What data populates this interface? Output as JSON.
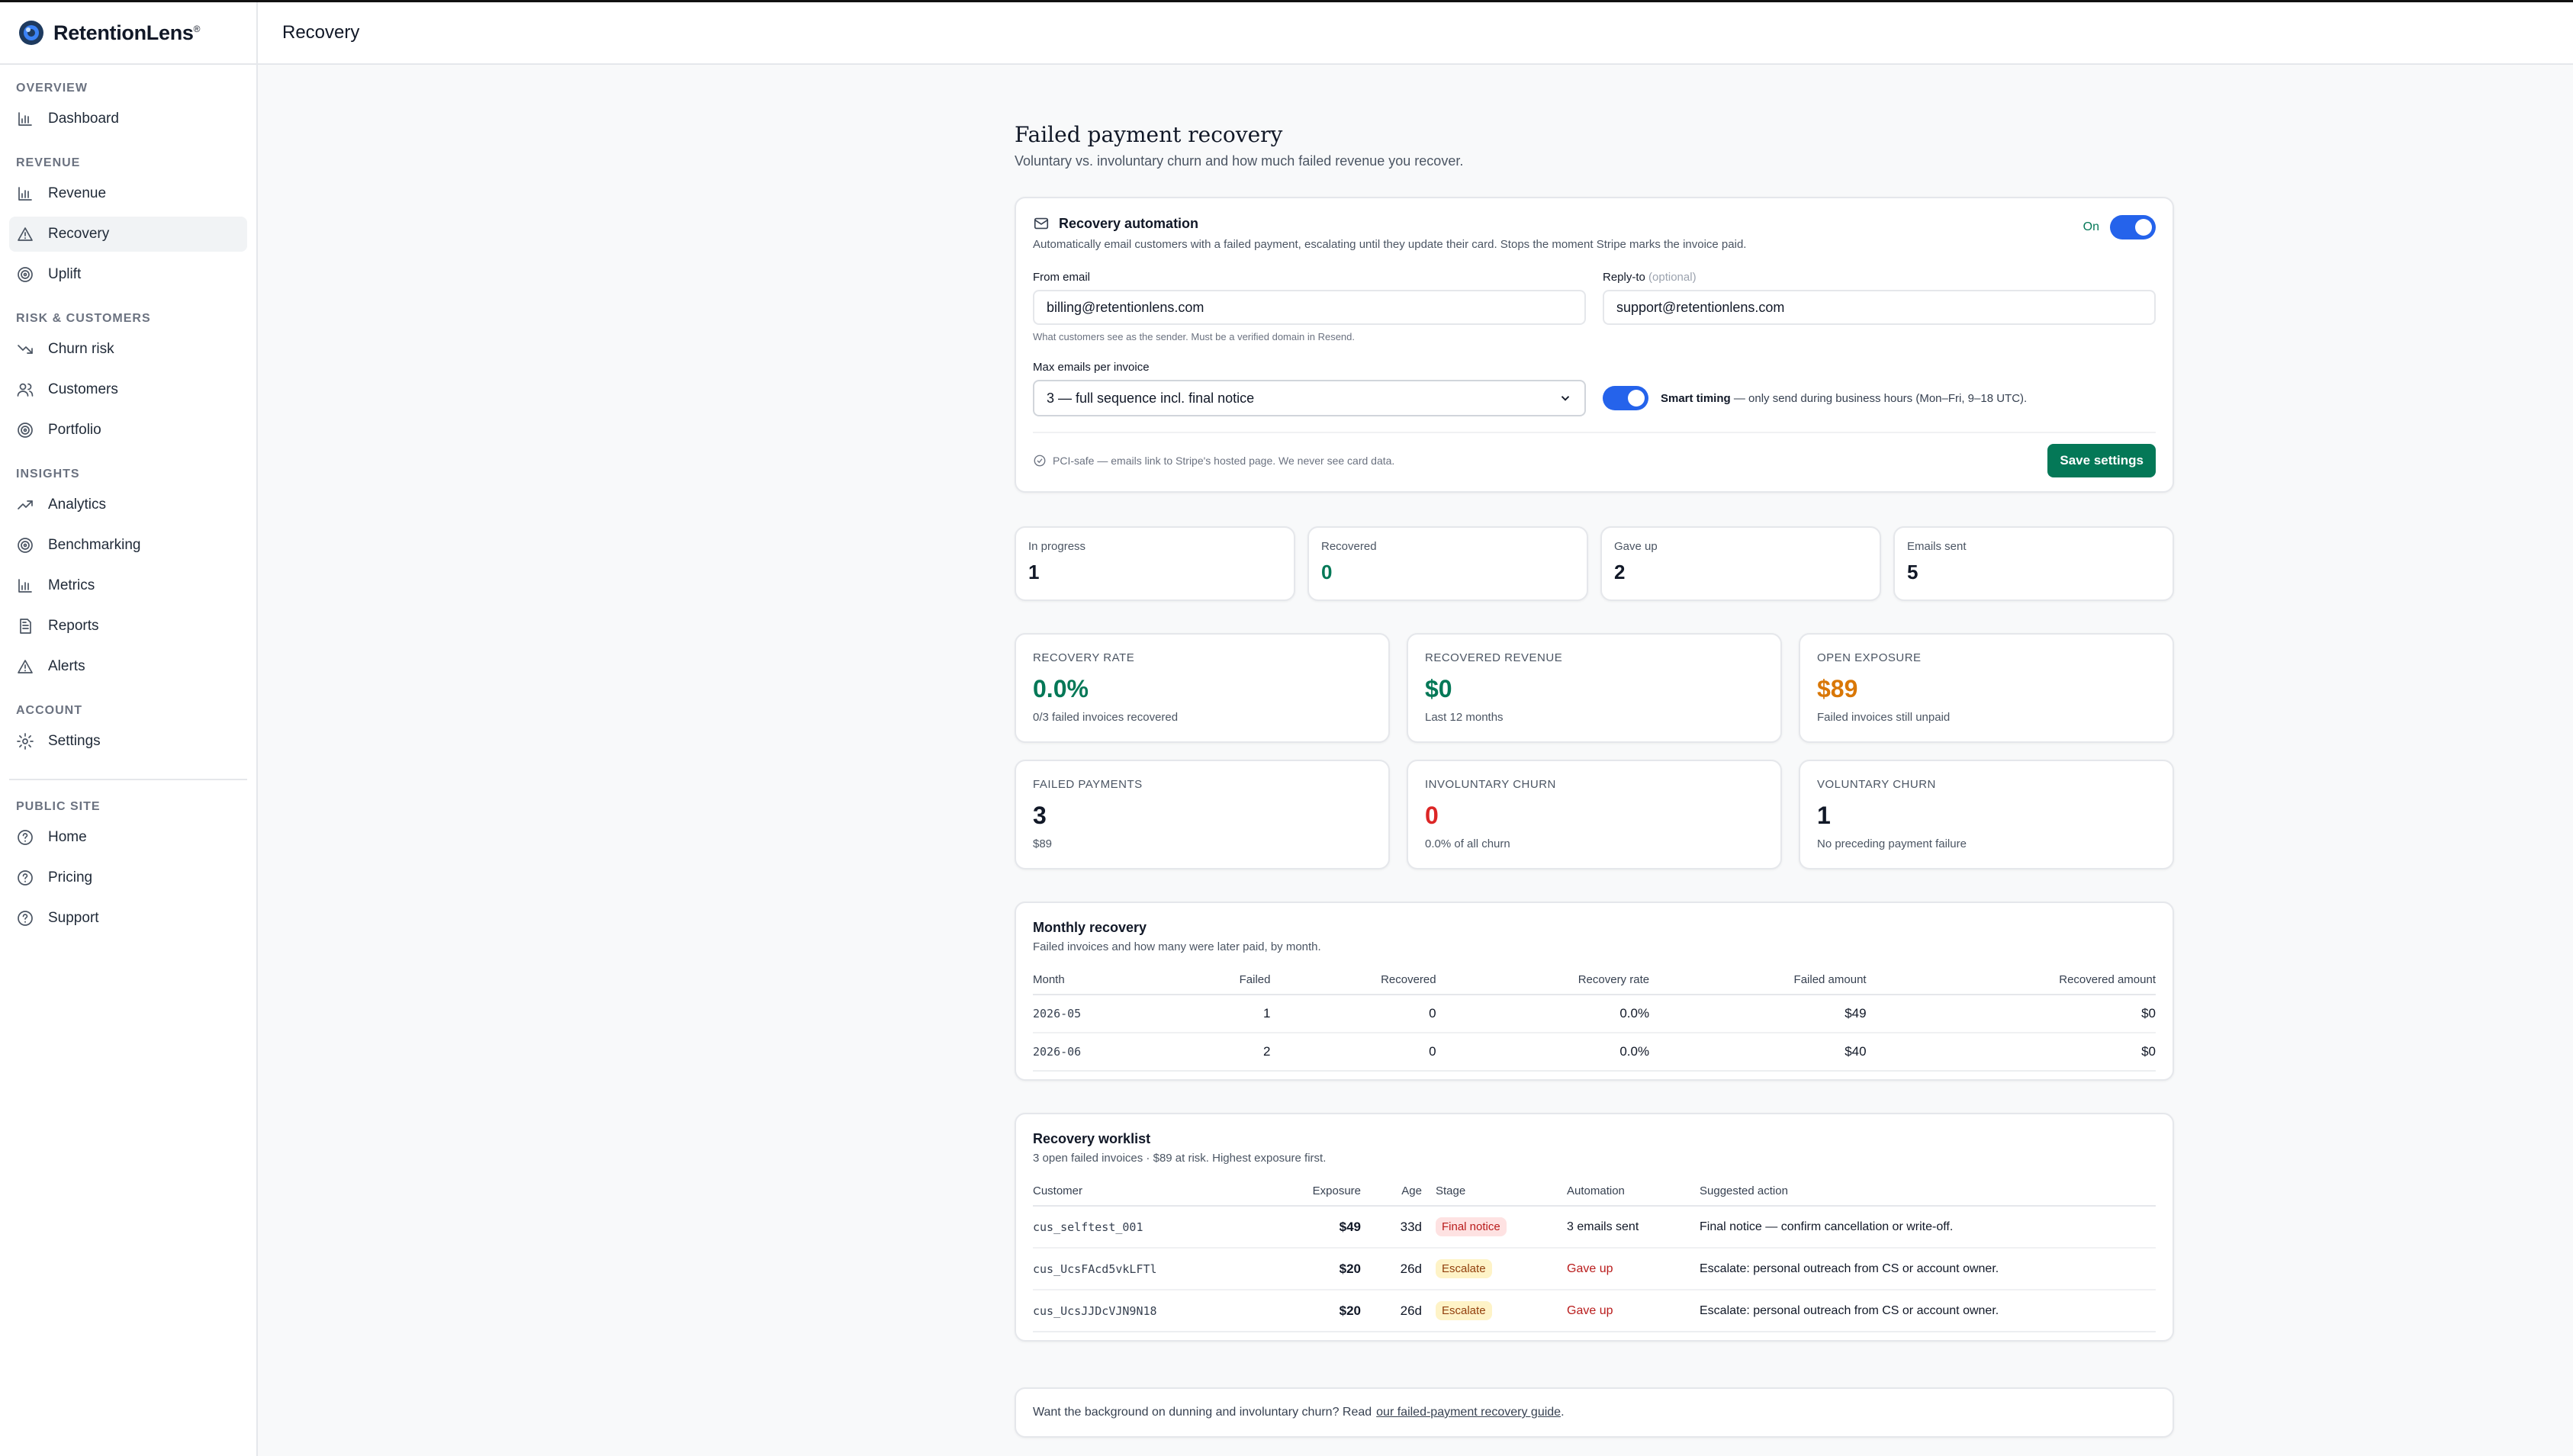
{
  "brand": {
    "name": "RetentionLens",
    "mark": "®"
  },
  "header": {
    "title": "Recovery"
  },
  "sidebar": {
    "sections": [
      {
        "heading": "Overview",
        "items": [
          {
            "label": "Dashboard",
            "icon": "bar-chart-icon"
          }
        ]
      },
      {
        "heading": "Revenue",
        "items": [
          {
            "label": "Revenue",
            "icon": "bar-chart-icon"
          },
          {
            "label": "Recovery",
            "icon": "warning-triangle-icon",
            "active": true
          },
          {
            "label": "Uplift",
            "icon": "target-icon"
          }
        ]
      },
      {
        "heading": "Risk & Customers",
        "items": [
          {
            "label": "Churn risk",
            "icon": "trending-down-icon"
          },
          {
            "label": "Customers",
            "icon": "users-icon"
          },
          {
            "label": "Portfolio",
            "icon": "target-icon"
          }
        ]
      },
      {
        "heading": "Insights",
        "items": [
          {
            "label": "Analytics",
            "icon": "trending-up-icon"
          },
          {
            "label": "Benchmarking",
            "icon": "target-icon"
          },
          {
            "label": "Metrics",
            "icon": "bar-chart-icon"
          },
          {
            "label": "Reports",
            "icon": "document-icon"
          },
          {
            "label": "Alerts",
            "icon": "warning-triangle-icon"
          }
        ]
      },
      {
        "heading": "Account",
        "items": [
          {
            "label": "Settings",
            "icon": "gear-icon"
          }
        ]
      },
      {
        "heading": "Public site",
        "items": [
          {
            "label": "Home",
            "icon": "help-circle-icon"
          },
          {
            "label": "Pricing",
            "icon": "help-circle-icon"
          },
          {
            "label": "Support",
            "icon": "help-circle-icon"
          }
        ]
      }
    ]
  },
  "page": {
    "title": "Failed payment recovery",
    "subtitle": "Voluntary vs. involuntary churn and how much failed revenue you recover."
  },
  "automation": {
    "title": "Recovery automation",
    "description": "Automatically email customers with a failed payment, escalating until they update their card. Stops the moment Stripe marks the invoice paid.",
    "toggle_label": "On",
    "from_label": "From email",
    "from_value": "billing@retentionlens.com",
    "from_hint": "What customers see as the sender. Must be a verified domain in Resend.",
    "reply_label": "Reply-to",
    "reply_optional": "(optional)",
    "reply_value": "support@retentionlens.com",
    "max_label": "Max emails per invoice",
    "max_value": "3 — full sequence incl. final notice",
    "smart_bold": "Smart timing",
    "smart_text": " — only send during business hours (Mon–Fri, 9–18 UTC).",
    "pci": "PCI-safe — emails link to Stripe's hosted page. We never see card data.",
    "save_label": "Save settings"
  },
  "stats": [
    {
      "label": "In progress",
      "value": "1",
      "color": "#111827"
    },
    {
      "label": "Recovered",
      "value": "0",
      "color": "#047857"
    },
    {
      "label": "Gave up",
      "value": "2",
      "color": "#111827"
    },
    {
      "label": "Emails sent",
      "value": "5",
      "color": "#111827"
    }
  ],
  "kpis": [
    {
      "label": "Recovery rate",
      "value": "0.0%",
      "sub": "0/3 failed invoices recovered",
      "color": "#047857"
    },
    {
      "label": "Recovered revenue",
      "value": "$0",
      "sub": "Last 12 months",
      "color": "#047857"
    },
    {
      "label": "Open exposure",
      "value": "$89",
      "sub": "Failed invoices still unpaid",
      "color": "#d97706"
    },
    {
      "label": "Failed payments",
      "value": "3",
      "sub": "$89",
      "color": "#111827"
    },
    {
      "label": "Involuntary churn",
      "value": "0",
      "sub": "0.0% of all churn",
      "color": "#dc2626"
    },
    {
      "label": "Voluntary churn",
      "value": "1",
      "sub": "No preceding payment failure",
      "color": "#111827"
    }
  ],
  "monthly": {
    "title": "Monthly recovery",
    "subtitle": "Failed invoices and how many were later paid, by month.",
    "columns": [
      "Month",
      "Failed",
      "Recovered",
      "Recovery rate",
      "Failed amount",
      "Recovered amount"
    ],
    "rows": [
      [
        "2026-05",
        "1",
        "0",
        "0.0%",
        "$49",
        "$0"
      ],
      [
        "2026-06",
        "2",
        "0",
        "0.0%",
        "$40",
        "$0"
      ]
    ]
  },
  "worklist": {
    "title": "Recovery worklist",
    "subtitle": "3 open failed invoices · $89 at risk. Highest exposure first.",
    "columns": [
      "Customer",
      "Exposure",
      "Age",
      "Stage",
      "Automation",
      "Suggested action"
    ],
    "rows": [
      {
        "customer": "cus_selftest_001",
        "exposure": "$49",
        "age": "33d",
        "stage": "Final notice",
        "stage_type": "final",
        "automation": "3 emails sent",
        "automation_type": "normal",
        "action": "Final notice — confirm cancellation or write-off."
      },
      {
        "customer": "cus_UcsFAcd5vkLFTl",
        "exposure": "$20",
        "age": "26d",
        "stage": "Escalate",
        "stage_type": "escalate",
        "automation": "Gave up",
        "automation_type": "gaveup",
        "action": "Escalate: personal outreach from CS or account owner."
      },
      {
        "customer": "cus_UcsJJDcVJN9N18",
        "exposure": "$20",
        "age": "26d",
        "stage": "Escalate",
        "stage_type": "escalate",
        "automation": "Gave up",
        "automation_type": "gaveup",
        "action": "Escalate: personal outreach from CS or account owner."
      }
    ]
  },
  "guide": {
    "text": "Want the background on dunning and involuntary churn? Read",
    "link": "our failed-payment recovery guide",
    "after": "."
  }
}
